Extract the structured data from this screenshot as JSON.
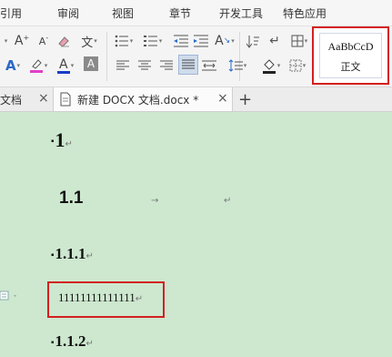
{
  "menu": {
    "items": [
      "引用",
      "审阅",
      "视图",
      "章节",
      "开发工具",
      "特色应用"
    ]
  },
  "ribbon": {
    "grow_font": "A",
    "shrink_font": "A",
    "phonetic": "文",
    "text_effect": "A",
    "font_color": "A",
    "char_shading": "A",
    "style_preview": "AaBbCcD",
    "style_name": "正文",
    "colors": {
      "highlight": "#e040c8",
      "font_color": "#1a3cc8",
      "accent_red": "#d42020"
    }
  },
  "tabs": {
    "left_partial": "文档",
    "active": "新建 DOCX 文档.docx *",
    "close": "×",
    "new": "+"
  },
  "document": {
    "heading1": "1",
    "heading2": "1.1",
    "heading3a": "1.1.1",
    "body": "11111111111111",
    "heading3b": "1.1.2",
    "para_mark": "↵",
    "tab_mark": "→"
  }
}
